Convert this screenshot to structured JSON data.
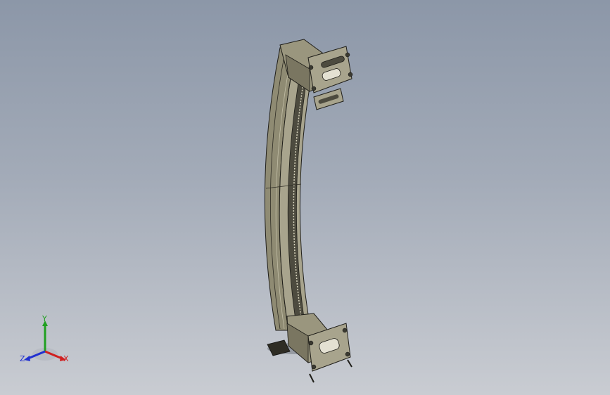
{
  "viewport": {
    "background_top": "#8c97a8",
    "background_bottom": "#c9ccd2"
  },
  "model": {
    "metal_light": "#a8a48d",
    "metal_mid": "#8a866f",
    "metal_dark": "#4d4b3f",
    "edge": "#1f1e19"
  },
  "triad": {
    "y_label": "Y",
    "x_label": "X",
    "z_label": "Z",
    "y_color": "#20a020",
    "x_color": "#d02020",
    "z_color": "#2030d0"
  }
}
